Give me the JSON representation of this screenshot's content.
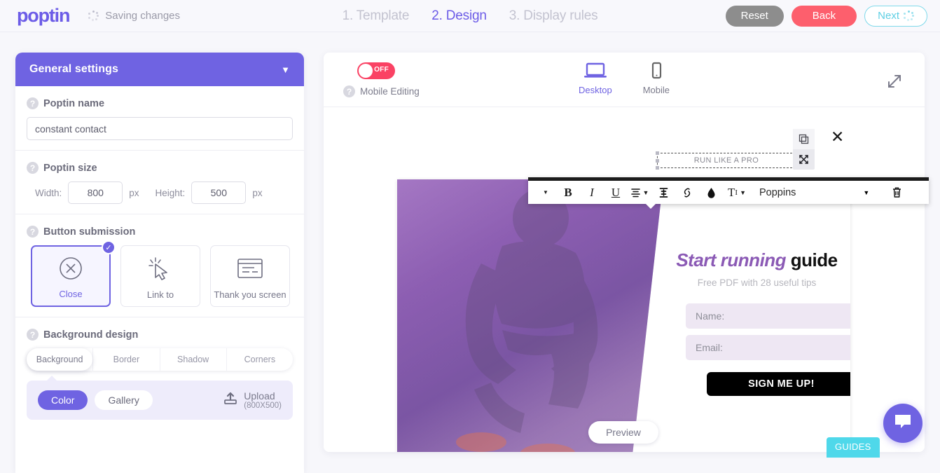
{
  "header": {
    "logo": "poptin",
    "saving_text": "Saving changes",
    "steps": [
      {
        "label": "1. Template",
        "active": false
      },
      {
        "label": "2. Design",
        "active": true
      },
      {
        "label": "3. Display rules",
        "active": false
      }
    ],
    "reset_label": "Reset",
    "back_label": "Back",
    "next_label": "Next"
  },
  "sidebar": {
    "panel_title": "General settings",
    "poptin_name": {
      "label": "Poptin name",
      "value": "constant contact"
    },
    "poptin_size": {
      "label": "Poptin size",
      "width_caption": "Width:",
      "width_value": "800",
      "height_caption": "Height:",
      "height_value": "500",
      "unit": "px"
    },
    "button_submission": {
      "label": "Button submission",
      "options": [
        {
          "caption": "Close",
          "icon": "close-circle-icon",
          "selected": true
        },
        {
          "caption": "Link to",
          "icon": "click-cursor-icon",
          "selected": false
        },
        {
          "caption": "Thank you screen",
          "icon": "window-icon",
          "selected": false
        }
      ]
    },
    "background_design": {
      "label": "Background design",
      "tabs": [
        {
          "label": "Background",
          "active": true
        },
        {
          "label": "Border",
          "active": false
        },
        {
          "label": "Shadow",
          "active": false
        },
        {
          "label": "Corners",
          "active": false
        }
      ],
      "color_pill": "Color",
      "gallery_pill": "Gallery",
      "upload_label": "Upload",
      "upload_size": "(800X500)"
    }
  },
  "canvas": {
    "mobile_editing": {
      "label": "Mobile Editing",
      "state": "OFF"
    },
    "devices": [
      {
        "label": "Desktop",
        "icon": "desktop-icon",
        "active": true
      },
      {
        "label": "Mobile",
        "icon": "mobile-icon",
        "active": false
      }
    ],
    "expand_icon": "expand-arrows-icon",
    "preview_label": "Preview",
    "guides_label": "GUIDES",
    "chat_icon": "chat-bubble-icon"
  },
  "popup": {
    "selected_text": "RUN LIKE A PRO",
    "headline_italic": "Start running",
    "headline_bold": "guide",
    "subline": "Free PDF with 28 useful tips",
    "name_field": "Name:",
    "email_field": "Email:",
    "cta_label": "SIGN ME UP!",
    "close_icon": "close-icon",
    "duplicate_icon": "duplicate-icon",
    "move_icon": "move-icon"
  },
  "text_toolbar": {
    "items": [
      {
        "name": "paragraph-dropdown",
        "glyph": "▾"
      },
      {
        "name": "bold-button",
        "glyph": "B"
      },
      {
        "name": "italic-button",
        "glyph": "I"
      },
      {
        "name": "underline-button",
        "glyph": "U"
      },
      {
        "name": "align-button",
        "glyph": "≡"
      },
      {
        "name": "line-height-button",
        "glyph": "↕"
      },
      {
        "name": "link-button",
        "glyph": "🔗"
      },
      {
        "name": "text-color-button",
        "glyph": "◆"
      },
      {
        "name": "font-size-button",
        "glyph": "T"
      }
    ],
    "font_name": "Poppins",
    "delete_icon": "trash-icon"
  },
  "colors": {
    "brand_purple": "#6f63e2",
    "accent_red": "#fd5f6d",
    "accent_cyan": "#4fd8ea",
    "gray": "#8d8d8d"
  }
}
